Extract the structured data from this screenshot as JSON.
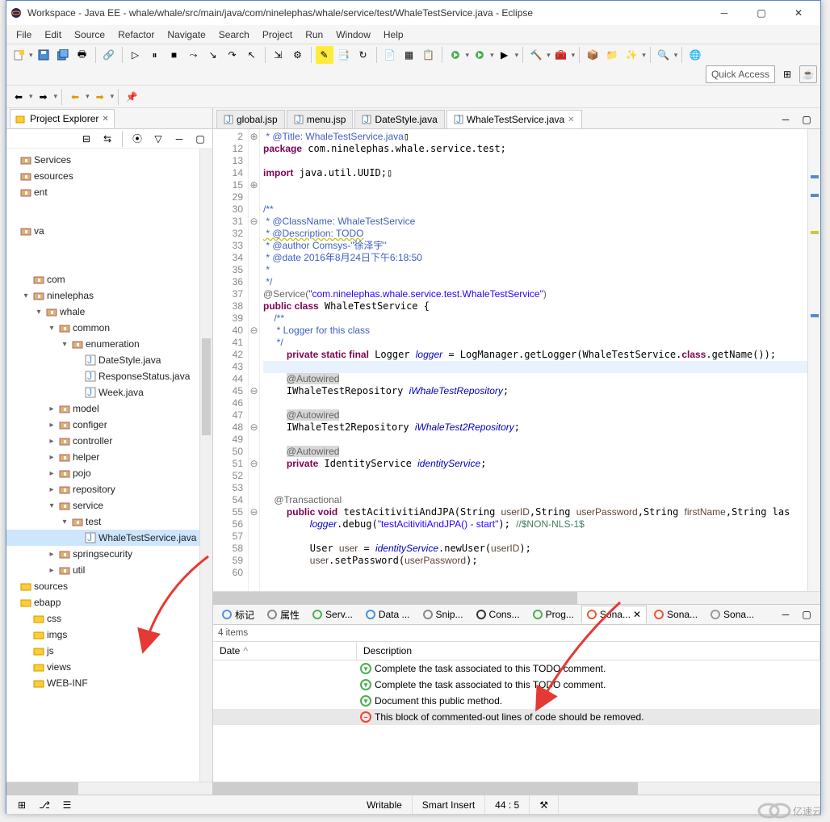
{
  "window": {
    "title": "Workspace - Java EE - whale/whale/src/main/java/com/ninelephas/whale/service/test/WhaleTestService.java - Eclipse"
  },
  "menu": [
    "File",
    "Edit",
    "Source",
    "Refactor",
    "Navigate",
    "Search",
    "Project",
    "Run",
    "Window",
    "Help"
  ],
  "quick_access": "Quick Access",
  "project_explorer": {
    "title": "Project Explorer",
    "nodes": [
      {
        "indent": 0,
        "label": "Services",
        "icon": "pkg"
      },
      {
        "indent": 0,
        "label": "esources",
        "icon": "pkg"
      },
      {
        "indent": 0,
        "label": "ent",
        "icon": "pkg"
      },
      {
        "indent": 0,
        "label": "va",
        "icon": "pkg"
      },
      {
        "indent": 1,
        "label": "com",
        "icon": "pkg",
        "tw": ""
      },
      {
        "indent": 1,
        "label": "ninelephas",
        "icon": "pkg",
        "tw": "▾"
      },
      {
        "indent": 2,
        "label": "whale",
        "icon": "pkg",
        "tw": "▾"
      },
      {
        "indent": 3,
        "label": "common",
        "icon": "pkg",
        "tw": "▾"
      },
      {
        "indent": 4,
        "label": "enumeration",
        "icon": "pkg",
        "tw": "▾"
      },
      {
        "indent": 5,
        "label": "DateStyle.java",
        "icon": "java"
      },
      {
        "indent": 5,
        "label": "ResponseStatus.java",
        "icon": "java"
      },
      {
        "indent": 5,
        "label": "Week.java",
        "icon": "java"
      },
      {
        "indent": 3,
        "label": "model",
        "icon": "pkg",
        "tw": "▸"
      },
      {
        "indent": 3,
        "label": "configer",
        "icon": "pkg",
        "tw": "▸"
      },
      {
        "indent": 3,
        "label": "controller",
        "icon": "pkg",
        "tw": "▸"
      },
      {
        "indent": 3,
        "label": "helper",
        "icon": "pkg",
        "tw": "▸"
      },
      {
        "indent": 3,
        "label": "pojo",
        "icon": "pkg",
        "tw": "▸"
      },
      {
        "indent": 3,
        "label": "repository",
        "icon": "pkg",
        "tw": "▸"
      },
      {
        "indent": 3,
        "label": "service",
        "icon": "pkg",
        "tw": "▾"
      },
      {
        "indent": 4,
        "label": "test",
        "icon": "pkg",
        "tw": "▾"
      },
      {
        "indent": 5,
        "label": "WhaleTestService.java",
        "icon": "java",
        "selected": true
      },
      {
        "indent": 3,
        "label": "springsecurity",
        "icon": "pkg",
        "tw": "▸"
      },
      {
        "indent": 3,
        "label": "util",
        "icon": "pkg",
        "tw": "▸"
      },
      {
        "indent": 0,
        "label": "sources",
        "icon": "folder"
      },
      {
        "indent": 0,
        "label": "ebapp",
        "icon": "folder"
      },
      {
        "indent": 1,
        "label": "css",
        "icon": "folder"
      },
      {
        "indent": 1,
        "label": "imgs",
        "icon": "folder"
      },
      {
        "indent": 1,
        "label": "js",
        "icon": "folder"
      },
      {
        "indent": 1,
        "label": "views",
        "icon": "folder"
      },
      {
        "indent": 1,
        "label": "WEB-INF",
        "icon": "folder"
      }
    ]
  },
  "editor_tabs": [
    {
      "label": "global.jsp",
      "active": false
    },
    {
      "label": "menu.jsp",
      "active": false
    },
    {
      "label": "DateStyle.java",
      "active": false
    },
    {
      "label": "WhaleTestService.java",
      "active": true
    }
  ],
  "code": {
    "line_start": 2,
    "line_numbers": [
      "2",
      "12",
      "13",
      "14",
      "15",
      "29",
      "30",
      "31",
      "32",
      "33",
      "34",
      "35",
      "36",
      "37",
      "38",
      "39",
      "40",
      "41",
      "42",
      "43",
      "44",
      "45",
      "46",
      "47",
      "48",
      "49",
      "50",
      "51",
      "52",
      "53",
      "54",
      "55",
      "56",
      "57",
      "58",
      "59",
      "60"
    ],
    "fold_marks": [
      "⊕",
      "",
      "",
      "",
      "⊕",
      "",
      "",
      "⊖",
      "",
      "",
      "",
      "",
      "",
      "",
      "",
      "",
      "⊖",
      "",
      "",
      "",
      "",
      "⊖",
      "",
      "",
      "⊖",
      "",
      "",
      "⊖",
      "",
      "",
      "",
      "⊖",
      "",
      "",
      "",
      "",
      ""
    ],
    "t_title": " * @Title: WhaleTestService.java",
    "t_pkg1": "package",
    "t_pkg2": " com.ninelephas.whale.service.test;",
    "t_imp1": "import",
    "t_imp2": " java.util.UUID;",
    "t_d1": "/**",
    "t_d2": " * @ClassName: WhaleTestService",
    "t_d3": " * @Description: TODO",
    "t_d4": " * @author Comsys-\"徐泽宇\"",
    "t_d5": " * @date 2016年8月24日下午6:18:50",
    "t_d6": " *",
    "t_d7": " */",
    "t_svc1": "@Service(",
    "t_svc2": "\"com.ninelephas.whale.service.test.WhaleTestService\"",
    "t_svc3": ")",
    "t_cls1": "public class",
    "t_cls2": " WhaleTestService {",
    "t_l1": "    /**",
    "t_l2": "     * Logger for this class",
    "t_l3": "     */",
    "t_log1": "    ",
    "t_log2": "private static final",
    "t_log3": " Logger ",
    "t_log4": "logger",
    "t_log5": " = LogManager.getLogger(WhaleTestService.",
    "t_log6": "class",
    "t_log7": ".getName());",
    "t_aw": "    @Autowired",
    "t_rep1": "    IWhaleTestRepository ",
    "t_rep1b": "iWhaleTestRepository",
    "t_rep1c": ";",
    "t_rep2": "    IWhaleTest2Repository ",
    "t_rep2b": "iWhaleTest2Repository",
    "t_rep2c": ";",
    "t_id1": "    ",
    "t_id2": "private",
    "t_id3": " IdentityService ",
    "t_id4": "identityService",
    "t_id5": ";",
    "t_tx": "    @Transactional",
    "t_m1": "    ",
    "t_m2": "public void",
    "t_m3": " testAcitivitiAndJPA(String ",
    "t_m4": "userID",
    "t_m5": ",String ",
    "t_m6": "userPassword",
    "t_m7": ",String ",
    "t_m8": "firstName",
    "t_m9": ",String las",
    "t_dbg1": "        ",
    "t_dbg2": "logger",
    "t_dbg3": ".debug(",
    "t_dbg4": "\"testAcitivitiAndJPA() - start\"",
    "t_dbg5": "); ",
    "t_dbg6": "//$NON-NLS-1$",
    "t_u1": "        User ",
    "t_u2": "user",
    "t_u3": " = ",
    "t_u4": "identityService",
    "t_u5": ".newUser(",
    "t_u6": "userID",
    "t_u7": ");",
    "t_p1": "        ",
    "t_p2": "user",
    "t_p3": ".setPassword(",
    "t_p4": "userPassword",
    "t_p5": ");"
  },
  "bottom_tabs": [
    {
      "label": "标记"
    },
    {
      "label": "属性"
    },
    {
      "label": "Serv..."
    },
    {
      "label": "Data ..."
    },
    {
      "label": "Snip..."
    },
    {
      "label": "Cons..."
    },
    {
      "label": "Prog..."
    },
    {
      "label": "Sona...",
      "active": true
    },
    {
      "label": "Sona..."
    },
    {
      "label": "Sona..."
    }
  ],
  "issues": {
    "count_label": "4 items",
    "col_date": "Date",
    "col_desc": "Description",
    "rows": [
      {
        "sev": "green",
        "desc": "Complete the task associated to this TODO comment."
      },
      {
        "sev": "green",
        "desc": "Complete the task associated to this TODO comment."
      },
      {
        "sev": "green",
        "desc": "Document this public method."
      },
      {
        "sev": "red",
        "desc": "This block of commented-out lines of code should be removed.",
        "selected": true
      }
    ]
  },
  "status": {
    "writable": "Writable",
    "insert": "Smart Insert",
    "cursor": "44 : 5"
  }
}
